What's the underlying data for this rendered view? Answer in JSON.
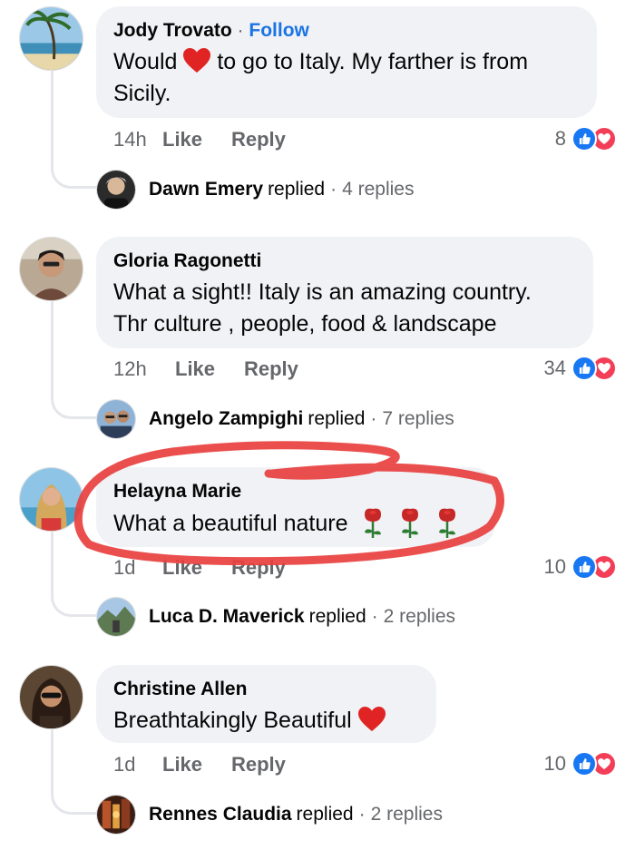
{
  "comments": [
    {
      "author": "Jody Trovato",
      "follow_label": "Follow",
      "text_before": "Would",
      "text_after": "to go to Italy. My farther is from",
      "text_line2": "Sicily.",
      "time": "14h",
      "like_label": "Like",
      "reply_label": "Reply",
      "reaction_count": "8",
      "reply_summary": {
        "name": "Dawn Emery",
        "replied": "replied",
        "count": "4 replies"
      }
    },
    {
      "author": "Gloria Ragonetti",
      "text_line1": "What a sight!! Italy is an amazing country.",
      "text_line2": "Thr culture , people, food & landscape",
      "time": "12h",
      "like_label": "Like",
      "reply_label": "Reply",
      "reaction_count": "34",
      "reply_summary": {
        "name": "Angelo Zampighi",
        "replied": "replied",
        "count": "7 replies"
      }
    },
    {
      "author": "Helayna Marie",
      "text_line1": "What a beautiful nature",
      "time": "1d",
      "like_label": "Like",
      "reply_label": "Reply",
      "reaction_count": "10",
      "reply_summary": {
        "name": "Luca D. Maverick",
        "replied": "replied",
        "count": "2 replies"
      }
    },
    {
      "author": "Christine Allen",
      "text_line1": "Breathtakingly Beautiful",
      "time": "1d",
      "like_label": "Like",
      "reply_label": "Reply",
      "reaction_count": "10",
      "reply_summary": {
        "name": "Rennes Claudia",
        "replied": "replied",
        "count": "2 replies"
      }
    }
  ],
  "separator": "·",
  "colors": {
    "accent": "#1b74e4",
    "like": "#1877f2",
    "love": "#f33e58",
    "bubble": "#f0f2f5",
    "highlight": "#e8403f"
  },
  "icons": [
    "heart-emoji-icon",
    "rose-emoji-icon",
    "like-reaction-icon",
    "love-reaction-icon"
  ]
}
